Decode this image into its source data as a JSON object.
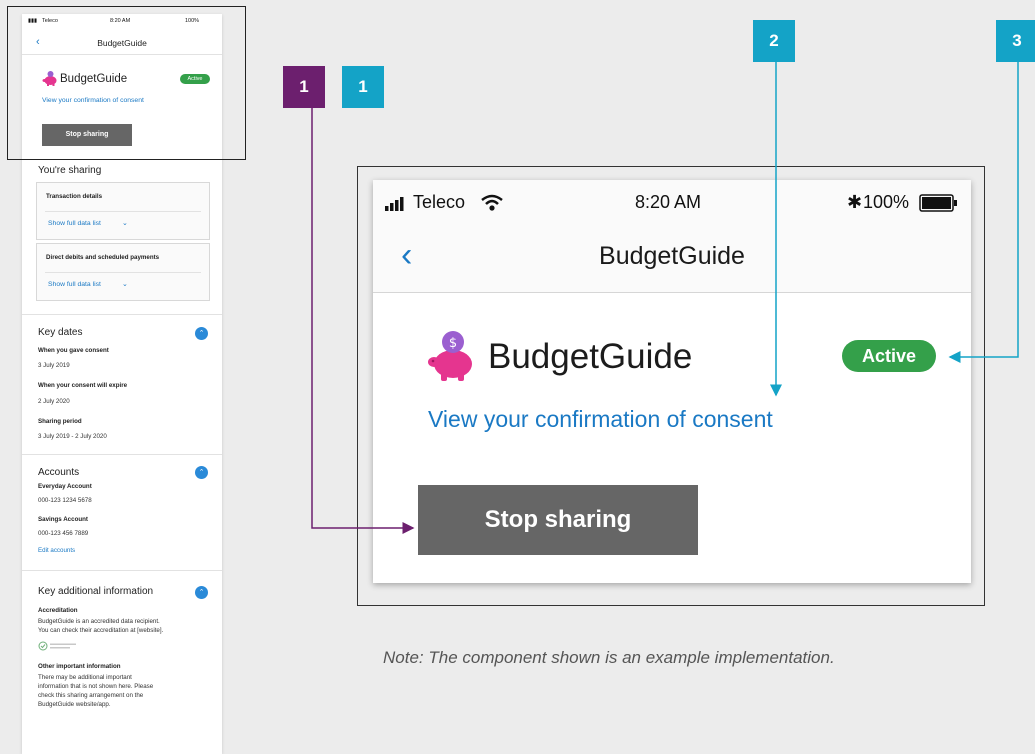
{
  "mini_phone": {
    "status": {
      "carrier": "Teleco",
      "time": "8:20 AM",
      "battery": "100%"
    },
    "title": "BudgetGuide",
    "app_name": "BudgetGuide",
    "badge": "Active",
    "link": "View your confirmation of consent",
    "stop_button": "Stop sharing",
    "sharing_heading": "You're sharing",
    "sharing_items": [
      {
        "title": "Transaction details",
        "link": "Show full data list"
      },
      {
        "title": "Direct debits and scheduled payments",
        "link": "Show full data list"
      }
    ],
    "key_dates": {
      "heading": "Key dates",
      "items": [
        {
          "label": "When you gave consent",
          "value": "3 July 2019"
        },
        {
          "label": "When your consent will expire",
          "value": "2 July 2020"
        },
        {
          "label": "Sharing period",
          "value": "3 July 2019 - 2 July 2020"
        }
      ]
    },
    "accounts": {
      "heading": "Accounts",
      "items": [
        {
          "name": "Everyday Account",
          "number": "000-123 1234 5678"
        },
        {
          "name": "Savings Account",
          "number": "000-123 456 7889"
        }
      ],
      "edit_link": "Edit accounts"
    },
    "additional": {
      "heading": "Key additional information",
      "accreditation_title": "Accreditation",
      "accreditation_lines": [
        "BudgetGuide is an accredited data recipient.",
        "You can check their accreditation at [website]."
      ],
      "other_title": "Other important information",
      "other_lines": [
        "There may be additional important",
        "information that is not shown here. Please",
        "check this sharing arrangement on the",
        "BudgetGuide website/app."
      ]
    }
  },
  "callouts": [
    "1",
    "1",
    "2",
    "3"
  ],
  "zoom": {
    "status": {
      "carrier": "Teleco",
      "time": "8:20 AM",
      "battery": "100%"
    },
    "title": "BudgetGuide",
    "app_name": "BudgetGuide",
    "badge": "Active",
    "link": "View your confirmation of consent",
    "stop_button": "Stop sharing"
  },
  "note": "Note: The component shown is an example implementation.",
  "colors": {
    "purple": "#6c1f6e",
    "teal": "#14a3c7",
    "active_green": "#34a04a",
    "link_blue": "#1a79c4",
    "button_grey": "#666666",
    "piggy_pink": "#e5358f"
  }
}
